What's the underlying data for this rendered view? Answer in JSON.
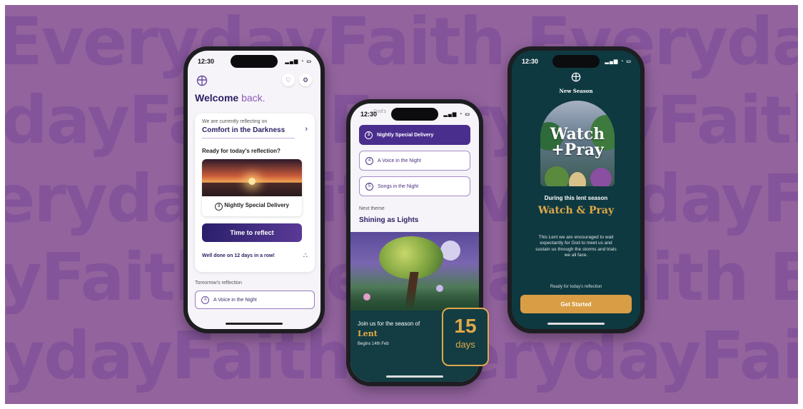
{
  "background": {
    "rows": [
      "EverydayFaith EverydayFaith EverydayFaith",
      "dayFaith EverydayFaith EverydayFaith Eve",
      "erydayFaith EverydayFaith EverydayFaith",
      "yFaith EverydayFaith EverydayFaith Every",
      "ydayFaith EverydayFaith EverydayFaith Ev"
    ],
    "color": "#93639e"
  },
  "phone1": {
    "time": "12:30",
    "welcome": "Welcome",
    "welcome_back": "back.",
    "reflecting_label": "We are currently reflecting on",
    "theme": "Comfort in the Darkness",
    "ready": "Ready for today's reflection?",
    "reflection_num": "3",
    "reflection_title": "Nightly Special Delivery",
    "reflect_button": "Time to reflect",
    "well_done": "Well done on 12 days in a row!",
    "tomorrow_label": "Tomorrow's reflection",
    "tomorrow_num": "4",
    "tomorrow_title": "A Voice in the Night"
  },
  "phone2": {
    "time": "12:30",
    "cut_text": "God's",
    "items": [
      {
        "num": "3",
        "title": "Nightly Special Delivery"
      },
      {
        "num": "4",
        "title": "A Voice in the Night"
      },
      {
        "num": "5",
        "title": "Songs in the Night"
      }
    ],
    "next_label": "Next theme",
    "next_title": "Shining as Lights",
    "join": "Join us for the season of",
    "lent": "Lent",
    "begins": "Begins 14th Feb",
    "days_num": "15",
    "days_unit": "days"
  },
  "phone3": {
    "time": "12:30",
    "new_season": "New Season",
    "art_title_1": "Watch",
    "art_title_2": "+Pray",
    "during": "During this lent season",
    "watch_pray": "Watch & Pray",
    "description": "This Lent we are encouraged to wait expectantly for God to meet us and sustain us through the storms and trials we all face.",
    "ready": "Ready for today's reflection",
    "button": "Get Started"
  }
}
